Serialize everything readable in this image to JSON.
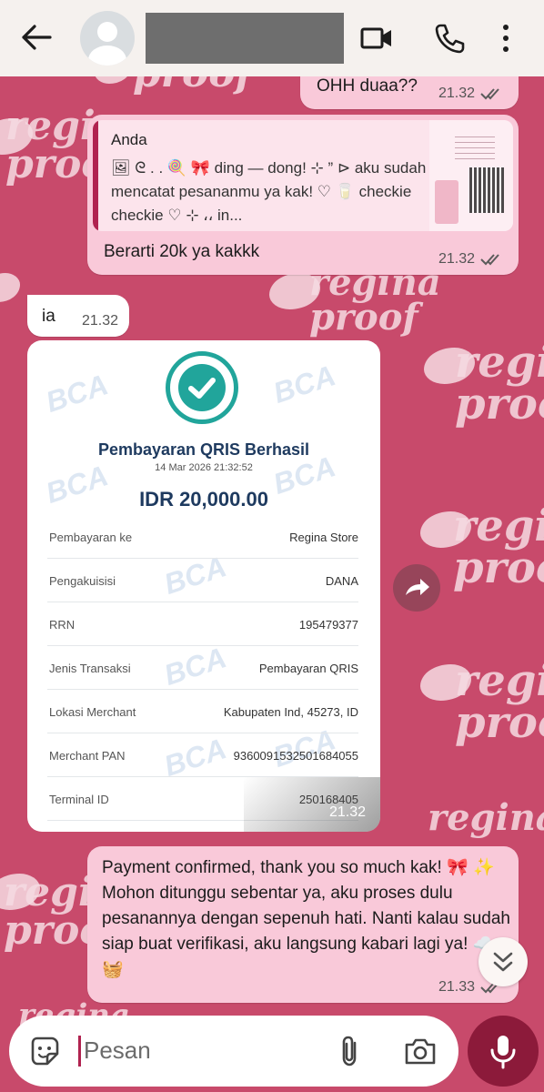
{
  "header": {
    "contact_name": "",
    "icons": [
      "back-arrow-icon",
      "video-call-icon",
      "phone-icon",
      "more-vertical-icon"
    ]
  },
  "wallpaper": {
    "watermark_line1": "regina",
    "watermark_line2": "proof"
  },
  "messages": [
    {
      "id": "m1",
      "direction": "out",
      "text": "OHH duaa??",
      "time": "21.32",
      "status": "read"
    },
    {
      "id": "m2",
      "direction": "out",
      "quote_author": "Anda",
      "quote_text": "🖼 ᘓ . . 🍭 🎀 ding — dong! ⊹ ” ⊳ aku sudah mencatat pesananmu ya kak! ♡ 🥛 checkie checkie ♡ ⊹ ،، in...",
      "text": "Berarti 20k ya kakkk",
      "time": "21.32",
      "status": "read"
    },
    {
      "id": "m3",
      "direction": "in",
      "text": "ia",
      "time": "21.32"
    },
    {
      "id": "m4",
      "direction": "in",
      "type": "image",
      "time": "21.32",
      "receipt": {
        "watermark": "BCA",
        "title": "Pembayaran QRIS Berhasil",
        "datetime": "14 Mar 2026 21:32:52",
        "amount": "IDR 20,000.00",
        "rows": [
          {
            "label": "Pembayaran ke",
            "value": "Regina Store"
          },
          {
            "label": "Pengakuisisi",
            "value": "DANA"
          },
          {
            "label": "RRN",
            "value": "195479377"
          },
          {
            "label": "Jenis Transaksi",
            "value": "Pembayaran QRIS"
          },
          {
            "label": "Lokasi Merchant",
            "value": "Kabupaten Ind, 45273, ID"
          },
          {
            "label": "Merchant PAN",
            "value": "9360091532501684055"
          },
          {
            "label": "Terminal ID",
            "value": "250168405"
          }
        ]
      }
    },
    {
      "id": "m5",
      "direction": "out",
      "text": "Payment confirmed, thank you so much kak! 🎀 ✨ Mohon ditunggu sebentar ya, aku proses dulu pesanannya dengan sepenuh hati. Nanti kalau sudah siap buat verifikasi, aku langsung kabari lagi ya! ☁️ 🧺",
      "time": "21.33",
      "status": "read"
    }
  ],
  "composer": {
    "placeholder": "Pesan",
    "icons": [
      "sticker-icon",
      "attach-icon",
      "camera-icon",
      "mic-icon"
    ]
  },
  "colors": {
    "wallpaper": "#c84a6b",
    "outgoing_bubble": "#f9c9d9",
    "incoming_bubble": "#ffffff",
    "quote_bar": "#b0224f",
    "mic_button": "#8c1a3a",
    "receipt_accent": "#21a59b",
    "receipt_text": "#1e3a5f"
  }
}
